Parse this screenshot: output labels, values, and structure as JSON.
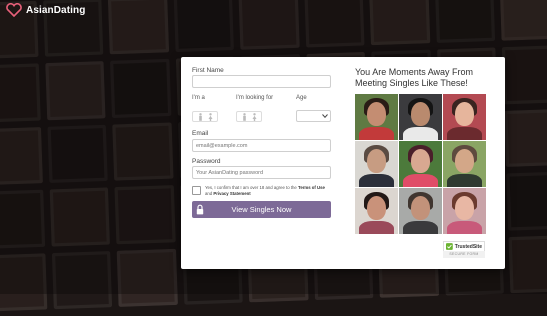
{
  "brand": {
    "name": "AsianDating"
  },
  "form": {
    "first_name_label": "First Name",
    "first_name_value": "",
    "im_a_label": "I'm a",
    "looking_for_label": "I'm looking for",
    "age_label": "Age",
    "age_value": "",
    "email_label": "Email",
    "email_placeholder": "email@example.com",
    "password_label": "Password",
    "password_placeholder": "Your AsianDating password",
    "terms_checked": false,
    "terms_prefix": "Yes, I confirm that I am over 18 and agree to the",
    "terms_link": "Terms of Use",
    "terms_and": "and",
    "privacy_link": "Privacy Statement",
    "submit_label": "View Singles Now"
  },
  "promo": {
    "title": "You Are Moments Away From Meeting Singles Like These!"
  },
  "badge": {
    "name": "TrustedSite",
    "sub": "SECURE FORM"
  },
  "colors": {
    "accent": "#7d6a97",
    "badge_green": "#6ab330"
  }
}
